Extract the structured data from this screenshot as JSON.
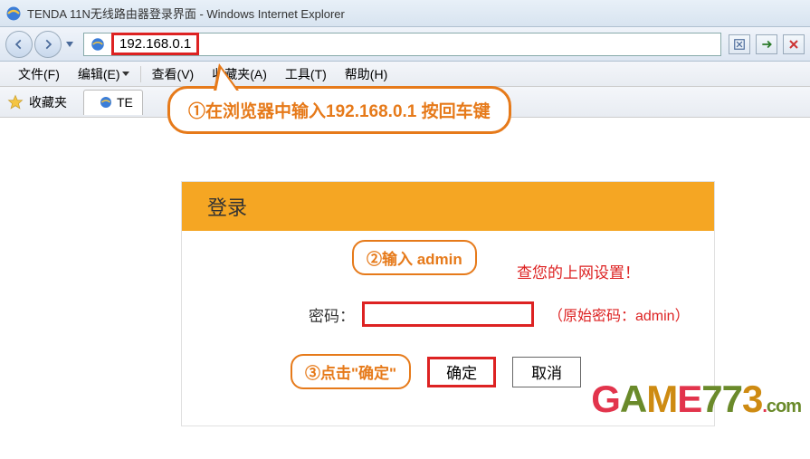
{
  "titlebar": {
    "title": "TENDA 11N无线路由器登录界面 - Windows Internet Explorer"
  },
  "url": "192.168.0.1",
  "menu": [
    "文件(F)",
    "编辑(E)",
    "查看(V)",
    "收藏夹(A)",
    "工具(T)",
    "帮助(H)"
  ],
  "favbar": {
    "label": "收藏夹",
    "tab": "TE"
  },
  "callout1": "①在浏览器中输入192.168.0.1 按回车键",
  "login": {
    "header": "登录",
    "callout2": "②输入 admin",
    "info": "查您的上网设置！",
    "pwd_label": "密码：",
    "pwd_hint": "（原始密码：admin）",
    "callout3": "③点击\"确定\"",
    "ok": "确定",
    "cancel": "取消"
  },
  "watermark": {
    "text": "GAME773",
    "suffix": ".com"
  }
}
